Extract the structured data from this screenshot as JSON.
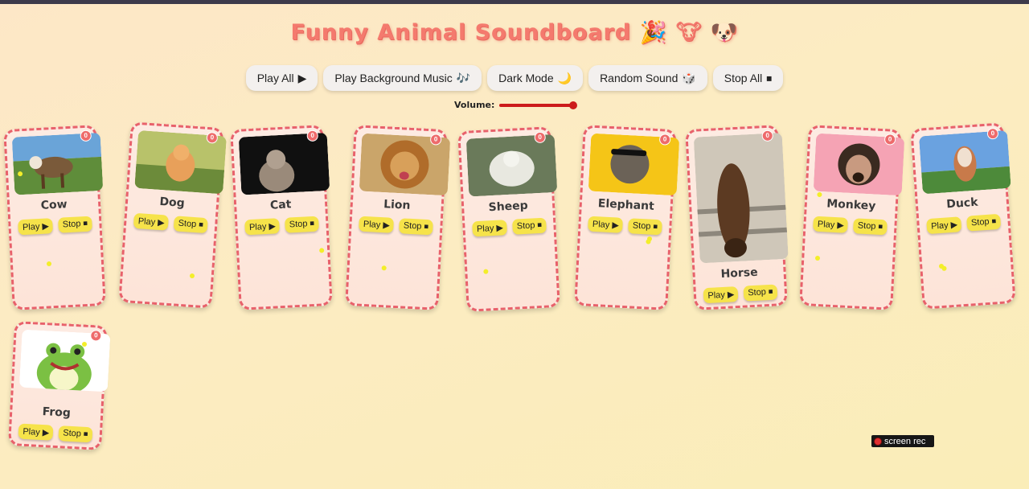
{
  "title": "Funny Animal Soundboard 🎉 🐮 🐶",
  "controls": [
    {
      "label": "Play All",
      "icon": "▶"
    },
    {
      "label": "Play Background Music",
      "icon": "🎶"
    },
    {
      "label": "Dark Mode",
      "icon": "🌙"
    },
    {
      "label": "Random Sound",
      "icon": "🎲"
    },
    {
      "label": "Stop All",
      "icon": "⏹"
    }
  ],
  "volume": {
    "label": "Volume:",
    "level": 1.0
  },
  "card_buttons": {
    "play": "Play ▶",
    "stop": "Stop ⏹"
  },
  "animals": [
    {
      "name": "Cow",
      "count": "0",
      "colors": [
        "#6aa4d8",
        "#7a5a3a",
        "#5f8d3a"
      ]
    },
    {
      "name": "Dog",
      "count": "0",
      "colors": [
        "#b8c26a",
        "#e8a05a",
        "#6c8b3a"
      ]
    },
    {
      "name": "Cat",
      "count": "0",
      "colors": [
        "#101010",
        "#9a8a7a",
        "#2a2a2a"
      ]
    },
    {
      "name": "Lion",
      "count": "0",
      "colors": [
        "#caa56a",
        "#b06c2a",
        "#8a6a4a"
      ]
    },
    {
      "name": "Sheep",
      "count": "0",
      "colors": [
        "#6a7a5a",
        "#e8e8e0",
        "#4a5a3a"
      ]
    },
    {
      "name": "Elephant",
      "count": "0",
      "colors": [
        "#f5c517",
        "#6b6257",
        "#e8b712"
      ]
    },
    {
      "name": "Horse",
      "count": "0",
      "colors": [
        "#cfc7b9",
        "#5c3a22",
        "#8d877c"
      ]
    },
    {
      "name": "Monkey",
      "count": "0",
      "colors": [
        "#f5a3b4",
        "#3a2a20",
        "#e88da0"
      ]
    },
    {
      "name": "Duck",
      "count": "0",
      "colors": [
        "#6aa2e0",
        "#c87a4a",
        "#4d8a3a"
      ]
    },
    {
      "name": "Frog",
      "count": "0",
      "colors": [
        "#ffffff",
        "#7bc043",
        "#f6f6e8"
      ]
    }
  ],
  "watermark": "screen rec"
}
